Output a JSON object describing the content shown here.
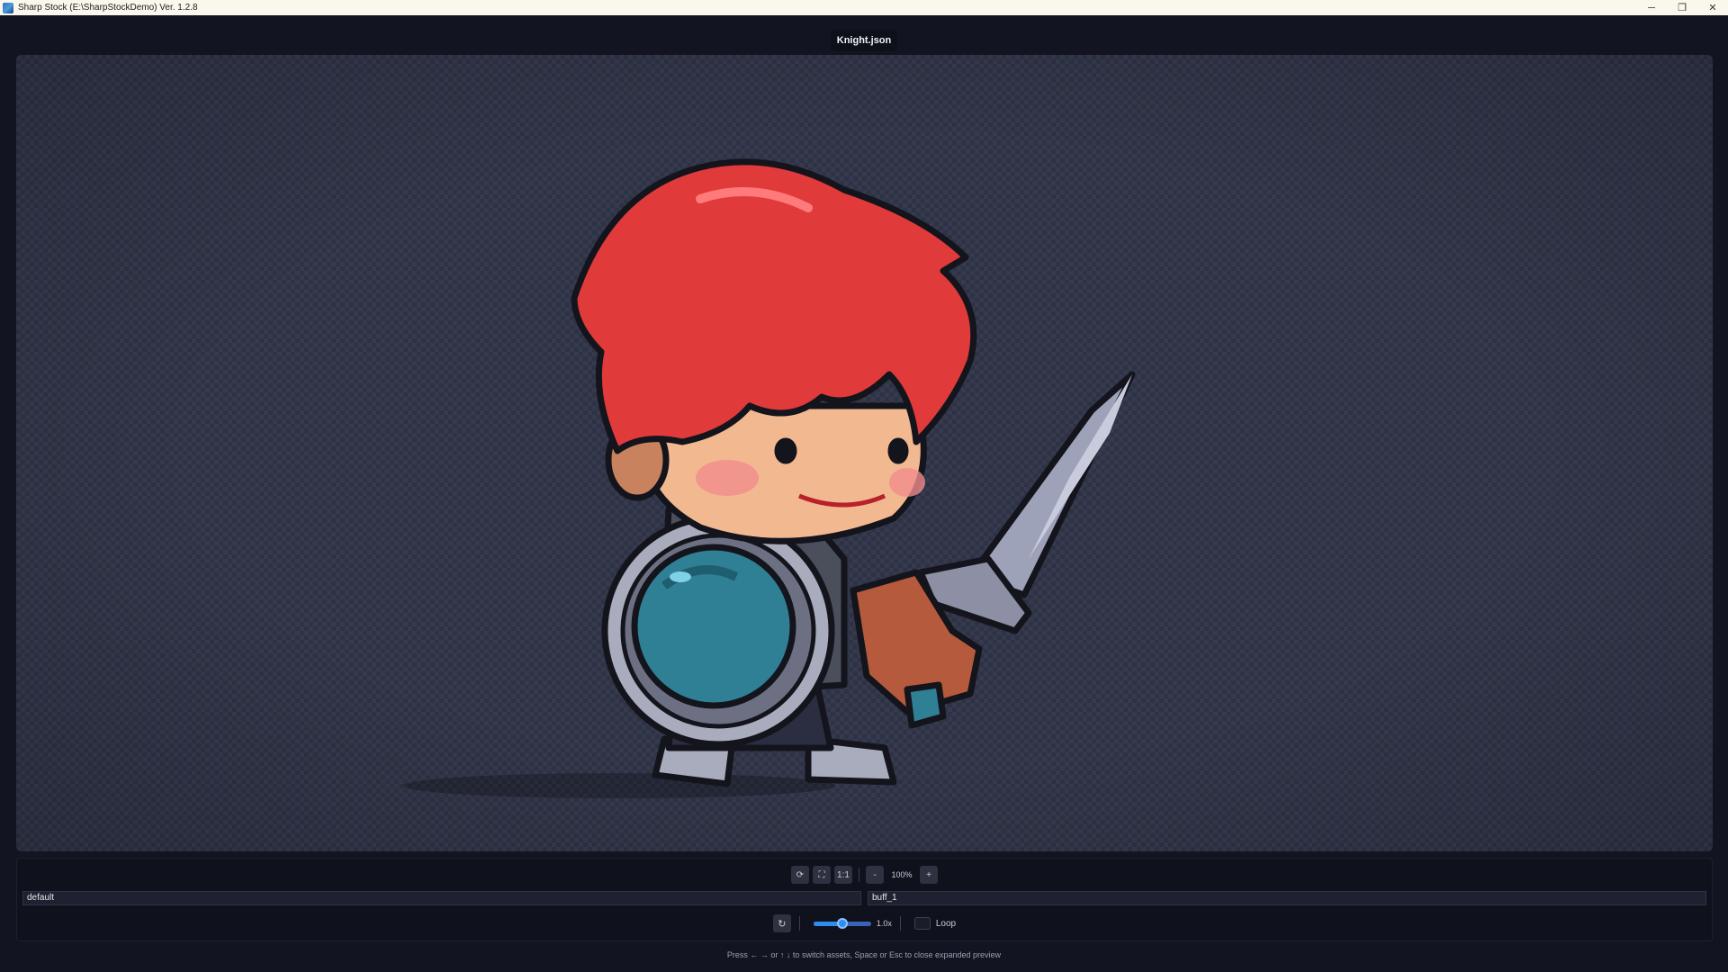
{
  "window": {
    "title": "Sharp Stock (E:\\SharpStockDemo) Ver. 1.2.8",
    "icon": "app-icon",
    "controls": {
      "minimize": "─",
      "restore": "❐",
      "close": "✕"
    }
  },
  "preview": {
    "file_tab": "Knight.json",
    "subject": "knight-character"
  },
  "toolbar": {
    "reset_icon": "⟳",
    "fit_icon": "⛶",
    "one_to_one_label": "1:1",
    "zoom_out_label": "-",
    "zoom_level": "100%",
    "zoom_in_label": "+"
  },
  "fields": {
    "skin": "default",
    "animation": "buff_1"
  },
  "playback": {
    "replay_icon": "↻",
    "speed_fraction": 0.5,
    "speed_label": "1.0x",
    "loop_checked": false,
    "loop_label": "Loop"
  },
  "hint": "Press ← → or ↑ ↓ to switch assets, Space or Esc to close expanded preview",
  "colors": {
    "background": "#121521",
    "accent": "#2f8df2",
    "hair": "#e03a3a",
    "shield_gem": "#2f7f95"
  }
}
